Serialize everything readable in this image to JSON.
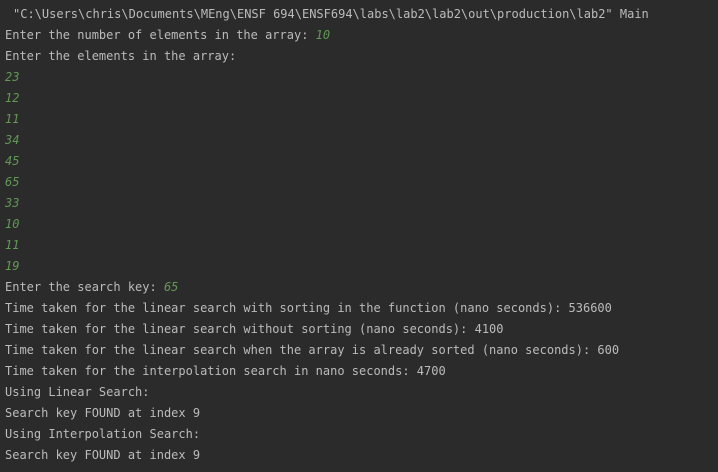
{
  "console": {
    "command": "\"C:\\Users\\chris\\Documents\\MEng\\ENSF 694\\ENSF694\\labs\\lab2\\lab2\\out\\production\\lab2\" Main",
    "prompt_count": "Enter the number of elements in the array: ",
    "input_count": "10",
    "prompt_elements": "Enter the elements in the array:",
    "elements": [
      "23",
      "12",
      "11",
      "34",
      "45",
      "65",
      "33",
      "10",
      "11",
      "19"
    ],
    "prompt_key": "Enter the search key: ",
    "input_key": "65",
    "time_linear_sorting": "Time taken for the linear search with sorting in the function (nano seconds): 536600",
    "time_linear_no_sort": "Time taken for the linear search without sorting (nano seconds): 4100",
    "time_linear_presorted": "Time taken for the linear search when the array is already sorted (nano seconds): 600",
    "time_interpolation": "Time taken for the interpolation search in nano seconds: 4700",
    "using_linear": "Using Linear Search:",
    "result_linear": "Search key FOUND at index 9",
    "using_interpolation": "Using Interpolation Search:",
    "result_interpolation": "Search key FOUND at index 9"
  },
  "colors": {
    "background": "#2b2b2b",
    "text": "#bbbbbb",
    "user_input": "#629755"
  }
}
